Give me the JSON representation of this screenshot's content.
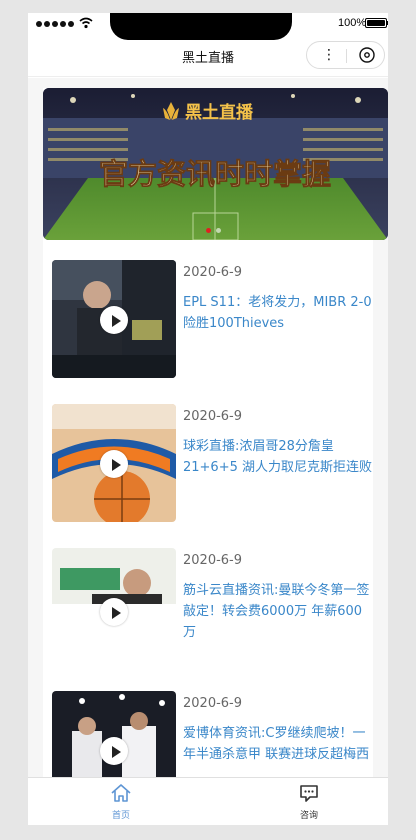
{
  "status_bar": {
    "battery": "100%",
    "icons": [
      "signal-dots",
      "wifi-icon",
      "battery-icon"
    ]
  },
  "nav": {
    "title": "黑土直播",
    "more": "⋮",
    "icons": [
      "more-icon",
      "close-circle-icon"
    ]
  },
  "banner": {
    "logo": "黑土直播",
    "slogan": "官方资讯时时掌握",
    "slide_count": 2,
    "active_slide": 1
  },
  "news": [
    {
      "date": "2020-6-9",
      "title": "EPL S11：老将发力，MIBR 2-0险胜100Thieves"
    },
    {
      "date": "2020-6-9",
      "title": "球彩直播:浓眉哥28分詹皇21+6+5 湖人力取尼克斯拒连败"
    },
    {
      "date": "2020-6-9",
      "title": "筋斗云直播资讯:曼联今冬第一签敲定！转会费6000万 年薪600万"
    },
    {
      "date": "2020-6-9",
      "title": "爱博体育资讯:C罗继续爬坡！一年半通杀意甲 联赛进球反超梅西"
    }
  ],
  "tabs": [
    {
      "label": "首页",
      "icon": "home-icon",
      "active": true
    },
    {
      "label": "咨询",
      "icon": "chat-icon",
      "active": false
    }
  ],
  "colors": {
    "accent": "#5e95d4",
    "title_blue": "#3a87c9",
    "dot_active": "#e02020"
  }
}
